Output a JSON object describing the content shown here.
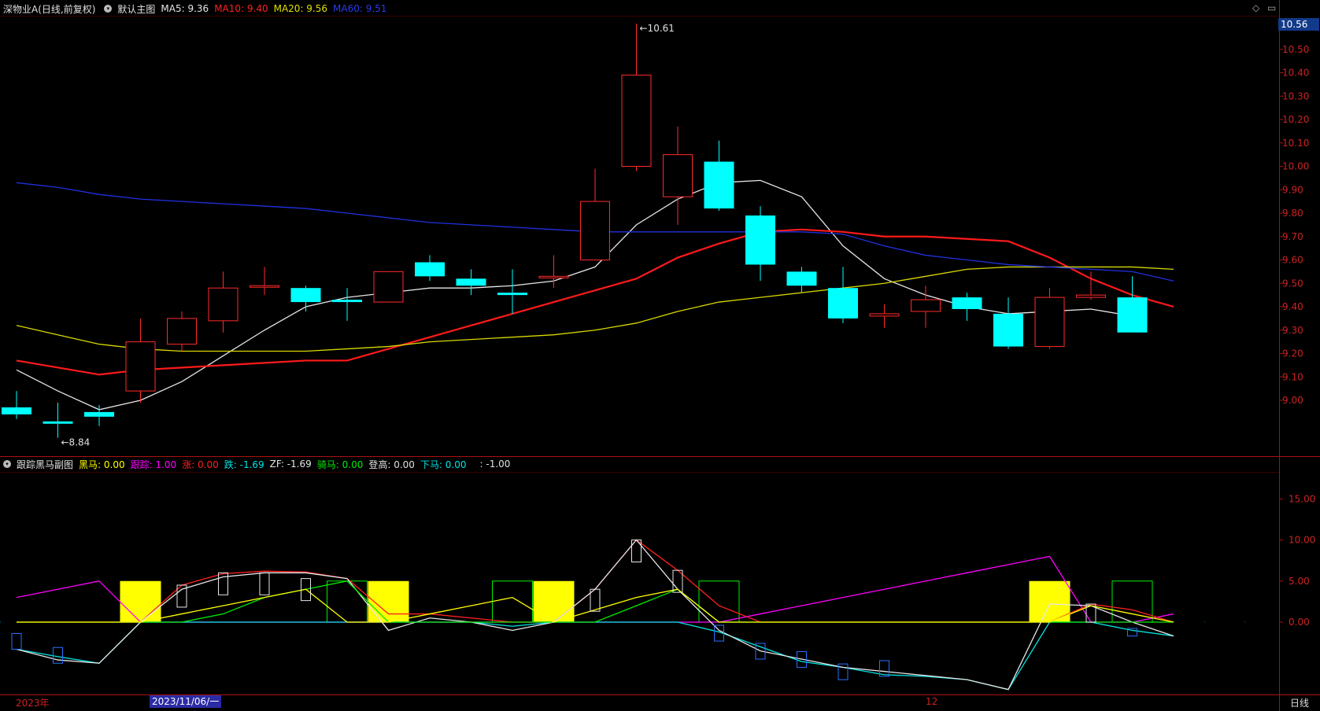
{
  "header": {
    "stock": "深物业A(日线,前复权)",
    "chart_name": "默认主图",
    "ma5": "MA5: 9.36",
    "ma10": "MA10: 9.40",
    "ma20": "MA20: 9.56",
    "ma60": "MA60: 9.51"
  },
  "sub_header": {
    "name": "跟踪黑马副图",
    "heima": "黑马: 0.00",
    "genzong": "跟踪: 1.00",
    "zhang": "涨: 0.00",
    "die": "跌: -1.69",
    "zf": "ZF: -1.69",
    "qima": "骑马: 0.00",
    "denggao": "登高: 0.00",
    "xiama": "下马: 0.00",
    "blank": ": -1.00"
  },
  "current_price_tag": "10.56",
  "corner_icons": [
    "◇",
    "▭"
  ],
  "date_tag": "2023/11/06/一",
  "period_label": "日线",
  "x_labels": [
    "2023年",
    "12"
  ],
  "colors": {
    "up": "#ff2a2a",
    "down": "#00ffff",
    "ma5": "#e6e6e6",
    "ma10": "#ff1a1a",
    "ma20": "#d8d800",
    "ma60": "#2030e0",
    "heima": "#ffff00",
    "genzong": "#ff00ff",
    "green": "#00ee00",
    "axis": "#aa1111"
  },
  "chart_data": [
    {
      "type": "candlestick",
      "title": "深物业A(日线,前复权)",
      "ylim": [
        8.75,
        10.62
      ],
      "y_ticks": [
        9.0,
        9.1,
        9.2,
        9.3,
        9.4,
        9.5,
        9.6,
        9.7,
        9.8,
        9.9,
        10.0,
        10.1,
        10.2,
        10.3,
        10.4,
        10.5
      ],
      "tick_labels": [
        "9.00",
        "9.10",
        "9.20",
        "9.30",
        "9.40",
        "9.50",
        "9.60",
        "9.70",
        "9.80",
        "9.90",
        "10.00",
        "10.10",
        "10.20",
        "10.30",
        "10.40",
        "10.50"
      ],
      "candles": [
        {
          "o": 8.97,
          "h": 9.04,
          "l": 8.92,
          "c": 8.94
        },
        {
          "o": 8.91,
          "h": 8.99,
          "l": 8.84,
          "c": 8.9
        },
        {
          "o": 8.95,
          "h": 8.98,
          "l": 8.89,
          "c": 8.93
        },
        {
          "o": 9.04,
          "h": 9.35,
          "l": 8.99,
          "c": 9.25
        },
        {
          "o": 9.24,
          "h": 9.38,
          "l": 9.21,
          "c": 9.35
        },
        {
          "o": 9.34,
          "h": 9.55,
          "l": 9.29,
          "c": 9.48
        },
        {
          "o": 9.49,
          "h": 9.57,
          "l": 9.45,
          "c": 9.49
        },
        {
          "o": 9.48,
          "h": 9.49,
          "l": 9.38,
          "c": 9.42
        },
        {
          "o": 9.43,
          "h": 9.48,
          "l": 9.34,
          "c": 9.42
        },
        {
          "o": 9.42,
          "h": 9.55,
          "l": 9.42,
          "c": 9.55
        },
        {
          "o": 9.59,
          "h": 9.62,
          "l": 9.51,
          "c": 9.53
        },
        {
          "o": 9.52,
          "h": 9.56,
          "l": 9.45,
          "c": 9.49
        },
        {
          "o": 9.46,
          "h": 9.56,
          "l": 9.37,
          "c": 9.45
        },
        {
          "o": 9.53,
          "h": 9.62,
          "l": 9.48,
          "c": 9.53
        },
        {
          "o": 9.6,
          "h": 9.99,
          "l": 9.6,
          "c": 9.85
        },
        {
          "o": 10.0,
          "h": 10.61,
          "l": 9.98,
          "c": 10.39
        },
        {
          "o": 9.87,
          "h": 10.17,
          "l": 9.75,
          "c": 10.05
        },
        {
          "o": 10.02,
          "h": 10.11,
          "l": 9.81,
          "c": 9.82
        },
        {
          "o": 9.79,
          "h": 9.83,
          "l": 9.51,
          "c": 9.58
        },
        {
          "o": 9.55,
          "h": 9.57,
          "l": 9.46,
          "c": 9.49
        },
        {
          "o": 9.48,
          "h": 9.57,
          "l": 9.33,
          "c": 9.35
        },
        {
          "o": 9.36,
          "h": 9.41,
          "l": 9.31,
          "c": 9.37
        },
        {
          "o": 9.38,
          "h": 9.49,
          "l": 9.31,
          "c": 9.43
        },
        {
          "o": 9.44,
          "h": 9.46,
          "l": 9.34,
          "c": 9.39
        },
        {
          "o": 9.37,
          "h": 9.44,
          "l": 9.22,
          "c": 9.23
        },
        {
          "o": 9.23,
          "h": 9.48,
          "l": 9.22,
          "c": 9.44
        },
        {
          "o": 9.44,
          "h": 9.55,
          "l": 9.43,
          "c": 9.45
        },
        {
          "o": 9.44,
          "h": 9.53,
          "l": 9.29,
          "c": 9.29
        }
      ],
      "series": [
        {
          "name": "MA5",
          "color": "#e6e6e6",
          "values": [
            9.13,
            9.04,
            8.96,
            9.0,
            9.08,
            9.19,
            9.3,
            9.4,
            9.44,
            9.46,
            9.48,
            9.48,
            9.49,
            9.51,
            9.57,
            9.75,
            9.86,
            9.93,
            9.94,
            9.87,
            9.66,
            9.52,
            9.45,
            9.4,
            9.37,
            9.38,
            9.39,
            9.36
          ]
        },
        {
          "name": "MA10",
          "color": "#ff1a1a",
          "values": [
            9.17,
            9.14,
            9.11,
            9.13,
            9.14,
            9.15,
            9.16,
            9.17,
            9.17,
            9.22,
            9.27,
            9.32,
            9.37,
            9.42,
            9.47,
            9.52,
            9.61,
            9.67,
            9.72,
            9.73,
            9.72,
            9.7,
            9.7,
            9.69,
            9.68,
            9.61,
            9.52,
            9.45,
            9.4
          ]
        },
        {
          "name": "MA20",
          "color": "#d8d800",
          "values": [
            9.32,
            9.28,
            9.24,
            9.22,
            9.21,
            9.21,
            9.21,
            9.21,
            9.22,
            9.23,
            9.25,
            9.26,
            9.27,
            9.28,
            9.3,
            9.33,
            9.38,
            9.42,
            9.44,
            9.46,
            9.48,
            9.5,
            9.53,
            9.56,
            9.57,
            9.57,
            9.57,
            9.57,
            9.56
          ]
        },
        {
          "name": "MA60",
          "color": "#2030e0",
          "values": [
            9.93,
            9.91,
            9.88,
            9.86,
            9.85,
            9.84,
            9.83,
            9.82,
            9.8,
            9.78,
            9.76,
            9.75,
            9.74,
            9.73,
            9.72,
            9.72,
            9.72,
            9.72,
            9.72,
            9.72,
            9.71,
            9.66,
            9.62,
            9.6,
            9.58,
            9.57,
            9.56,
            9.55,
            9.51
          ]
        }
      ],
      "annotations": [
        {
          "text": "10.61",
          "x_index": 15,
          "value": 10.61
        },
        {
          "text": "8.84",
          "x_index": 1,
          "value": 8.84
        }
      ]
    },
    {
      "type": "indicator",
      "title": "跟踪黑马副图",
      "ylim": [
        -8.5,
        20
      ],
      "y_ticks": [
        0,
        5,
        10,
        15
      ],
      "tick_labels": [
        "0.00",
        "5.00",
        "10.00",
        "15.00"
      ],
      "heima_blocks": [
        3,
        9,
        13,
        25
      ],
      "green_blocks": [
        8,
        12,
        17,
        27
      ],
      "zhang_bars": [
        {
          "x_index": 4,
          "value": 4.5
        },
        {
          "x_index": 5,
          "value": 6.0
        },
        {
          "x_index": 6,
          "value": 6.0
        },
        {
          "x_index": 7,
          "value": 5.3
        },
        {
          "x_index": 14,
          "value": 4.0
        },
        {
          "x_index": 15,
          "value": 10.0
        },
        {
          "x_index": 16,
          "value": 6.3
        },
        {
          "x_index": 26,
          "value": 2.2
        }
      ],
      "die_bars": [
        {
          "x_index": 0,
          "value": -3.3
        },
        {
          "x_index": 1,
          "value": -5.0
        },
        {
          "x_index": 17,
          "value": -2.3
        },
        {
          "x_index": 18,
          "value": -4.5
        },
        {
          "x_index": 19,
          "value": -5.5
        },
        {
          "x_index": 20,
          "value": -7.0
        },
        {
          "x_index": 21,
          "value": -6.6
        },
        {
          "x_index": 27,
          "value": -1.69
        }
      ],
      "series": [
        {
          "name": "跟踪",
          "color": "#ff00ff",
          "values": [
            3.0,
            4.0,
            5.0,
            0.0,
            0.0,
            0.0,
            0.0,
            0.0,
            0.0,
            0.0,
            0.0,
            0.0,
            0.0,
            0.0,
            0.0,
            0.0,
            0.0,
            0.0,
            1.0,
            2.0,
            3.0,
            4.0,
            5.0,
            6.0,
            7.0,
            8.0,
            0.0,
            0.0,
            1.0
          ]
        },
        {
          "name": "涨",
          "color": "#ff2020",
          "values": [
            0.0,
            0.0,
            0.0,
            0.0,
            4.5,
            5.9,
            6.2,
            6.1,
            5.3,
            1.0,
            1.0,
            0.5,
            0.0,
            0.0,
            4.0,
            10.0,
            6.3,
            2.0,
            0.0,
            0.0,
            0.0,
            0.0,
            0.0,
            0.0,
            0.0,
            0.0,
            2.2,
            1.5,
            0.0
          ]
        },
        {
          "name": "跌",
          "color": "#00e5e5",
          "values": [
            -3.3,
            -4.2,
            -5.0,
            0.0,
            0.0,
            0.0,
            0.0,
            0.0,
            0.0,
            0.0,
            0.0,
            0.0,
            -0.5,
            0.0,
            0.0,
            0.0,
            0.0,
            -1.2,
            -3.0,
            -4.8,
            -5.5,
            -6.4,
            -6.6,
            -7.0,
            -8.2,
            0.0,
            0.0,
            -1.0,
            -1.69
          ]
        },
        {
          "name": "ZF",
          "color": "#e6e6e6",
          "values": [
            -3.3,
            -4.6,
            -5.0,
            0.0,
            4.0,
            5.5,
            6.0,
            6.0,
            5.3,
            -1.0,
            0.5,
            0.0,
            -1.0,
            0.0,
            4.0,
            10.0,
            4.0,
            -1.0,
            -3.5,
            -4.5,
            -5.5,
            -6.0,
            -6.5,
            -7.0,
            -8.2,
            2.2,
            2.0,
            0.0,
            -1.69
          ]
        },
        {
          "name": "骑马",
          "color": "#00ee00",
          "values": [
            0.0,
            0.0,
            0.0,
            0.0,
            0.0,
            1.0,
            3.0,
            4.0,
            5.0,
            0.0,
            0.0,
            0.0,
            0.0,
            0.0,
            0.0,
            2.0,
            4.0,
            0.0,
            0.0,
            0.0,
            0.0,
            0.0,
            0.0,
            0.0,
            0.0,
            0.0,
            0.0,
            0.0,
            0.0
          ]
        },
        {
          "name": "黑马线",
          "color": "#ffff00",
          "values": [
            0.0,
            0.0,
            0.0,
            0.0,
            1.0,
            2.0,
            3.0,
            4.0,
            0.0,
            0.0,
            1.0,
            2.0,
            3.0,
            0.0,
            1.5,
            3.0,
            4.0,
            0.0,
            0.0,
            0.0,
            0.0,
            0.0,
            0.0,
            0.0,
            0.0,
            0.0,
            2.0,
            1.0,
            0.0
          ]
        }
      ]
    }
  ]
}
